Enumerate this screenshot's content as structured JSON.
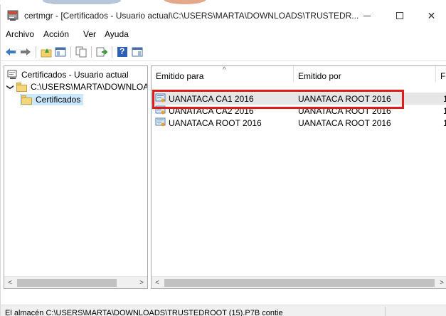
{
  "window": {
    "title": "certmgr - [Certificados - Usuario actual\\C:\\USERS\\MARTA\\DOWNLOADS\\TRUSTEDR...",
    "minimize_glyph": "—",
    "close_glyph": "✕"
  },
  "menu": [
    "Archivo",
    "Acción",
    "Ver",
    "Ayuda"
  ],
  "toolbar": {
    "icons": [
      "back-arrow-icon",
      "forward-arrow-icon",
      "up-folder-icon",
      "show-hide-tree-icon",
      "copy-icon",
      "export-icon",
      "help-icon",
      "properties-pane-icon"
    ],
    "help_glyph": "?"
  },
  "tree": {
    "root": "Certificados - Usuario actual",
    "store": "C:\\USERS\\MARTA\\DOWNLOA",
    "folder": "Certificados",
    "chevron": "❯"
  },
  "list": {
    "columns": [
      "Emitido para",
      "Emitido por",
      "F"
    ],
    "rows": [
      {
        "issued_to": "UANATACA CA1 2016",
        "issued_by": "UANATACA ROOT 2016",
        "f": "1"
      },
      {
        "issued_to": "UANATACA CA2 2016",
        "issued_by": "UANATACA ROOT 2016",
        "f": "1"
      },
      {
        "issued_to": "UANATACA ROOT 2016",
        "issued_by": "UANATACA ROOT 2016",
        "f": "1"
      }
    ],
    "sort_glyph": "^"
  },
  "scroll": {
    "left": "<",
    "right": ">"
  },
  "status": {
    "text": "El almacén C:\\USERS\\MARTA\\DOWNLOADS\\TRUSTEDROOT (15).P7B contie"
  },
  "colors": {
    "highlight": "#e21a1a",
    "selection": "#cce8ff",
    "row_selected": "#e6e6e6"
  }
}
